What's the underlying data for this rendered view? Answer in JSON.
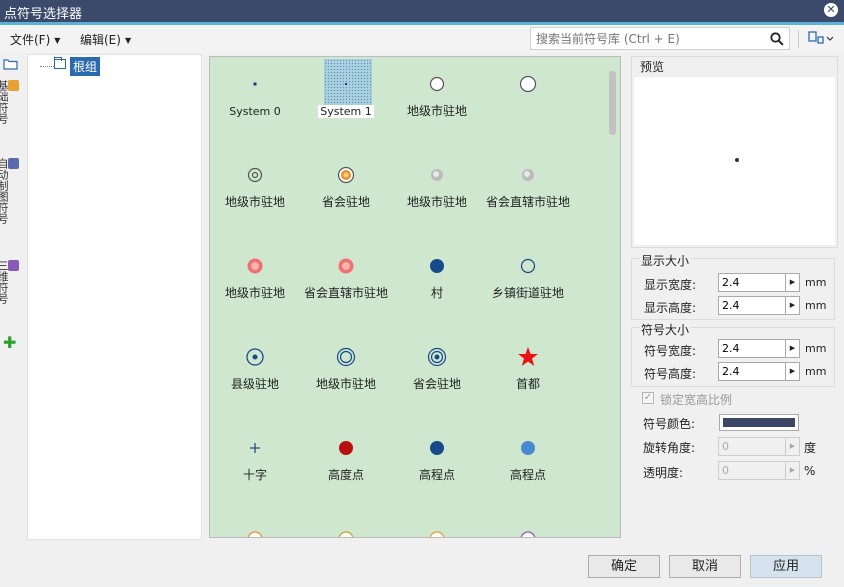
{
  "window": {
    "title": "点符号选择器",
    "close_glyph": "✕"
  },
  "menu": {
    "file": "文件(F)",
    "edit": "编辑(E)"
  },
  "search": {
    "placeholder": "搜索当前符号库 (Ctrl + E)"
  },
  "left_tabs": [
    {
      "label": "基础符号",
      "color": "#e8a030"
    },
    {
      "label": "自动制图符号",
      "color": "#5a6ab0"
    },
    {
      "label": "三维符号",
      "color": "#8a5ab8"
    }
  ],
  "add_glyph": "✚",
  "tree": {
    "root_label": "根组"
  },
  "symbols": [
    {
      "name": "System 0",
      "icon": "small-dot",
      "color": "#1f3a6b"
    },
    {
      "name": "System 1",
      "icon": "tiny-dot",
      "color": "#1f3a6b",
      "selected": true
    },
    {
      "name": "地级市驻地",
      "icon": "open-circle",
      "color": "#555555"
    },
    {
      "name": "",
      "icon": "open-circle-large",
      "color": "#555555"
    },
    {
      "name": "地级市驻地",
      "icon": "target-circle",
      "color": "#555555"
    },
    {
      "name": "省会驻地",
      "icon": "orange-ring",
      "color": "#e89030"
    },
    {
      "name": "地级市驻地",
      "icon": "grey-sphere",
      "color": "#bbbbbb"
    },
    {
      "name": "省会直辖市驻地",
      "icon": "grey-sphere",
      "color": "#bbbbbb"
    },
    {
      "name": "地级市驻地",
      "icon": "pink-sphere",
      "color": "#f07070"
    },
    {
      "name": "省会直辖市驻地",
      "icon": "pink-sphere",
      "color": "#f07070"
    },
    {
      "name": "村",
      "icon": "filled-circle",
      "color": "#174a8a"
    },
    {
      "name": "乡镇街道驻地",
      "icon": "open-circle-blue",
      "color": "#174a8a"
    },
    {
      "name": "县级驻地",
      "icon": "dot-in-circle",
      "color": "#174a8a"
    },
    {
      "name": "地级市驻地",
      "icon": "double-circle",
      "color": "#174a8a"
    },
    {
      "name": "省会驻地",
      "icon": "bullseye",
      "color": "#174a8a"
    },
    {
      "name": "首都",
      "icon": "red-star",
      "color": "#ee1111"
    },
    {
      "name": "十字",
      "icon": "cross",
      "color": "#174a8a"
    },
    {
      "name": "高度点",
      "icon": "filled-circle",
      "color": "#b81010"
    },
    {
      "name": "高程点",
      "icon": "filled-circle",
      "color": "#174a8a"
    },
    {
      "name": "高程点",
      "icon": "filled-circle",
      "color": "#4a88d0"
    },
    {
      "name": "",
      "icon": "partial-icon",
      "color": "#e89030"
    },
    {
      "name": "",
      "icon": "partial-icon",
      "color": "#c8a030"
    },
    {
      "name": "",
      "icon": "partial-icon",
      "color": "#e8a030"
    },
    {
      "name": "",
      "icon": "partial-icon",
      "color": "#8a5ab8"
    }
  ],
  "preview": {
    "label": "预览"
  },
  "display_size": {
    "label": "显示大小",
    "width_label": "显示宽度:",
    "width_value": "2.4",
    "width_unit": "mm",
    "height_label": "显示高度:",
    "height_value": "2.4",
    "height_unit": "mm"
  },
  "symbol_size": {
    "label": "符号大小",
    "width_label": "符号宽度:",
    "width_value": "2.4",
    "width_unit": "mm",
    "height_label": "符号高度:",
    "height_value": "2.4",
    "height_unit": "mm"
  },
  "lock_ratio": {
    "label": "锁定宽高比例",
    "checked": true
  },
  "symbol_color": {
    "label": "符号颜色:",
    "value": "#3b4764"
  },
  "rotation": {
    "label": "旋转角度:",
    "value": "0",
    "unit": "度"
  },
  "opacity": {
    "label": "透明度:",
    "value": "0",
    "unit": "%"
  },
  "buttons": {
    "ok": "确定",
    "cancel": "取消",
    "apply": "应用"
  }
}
